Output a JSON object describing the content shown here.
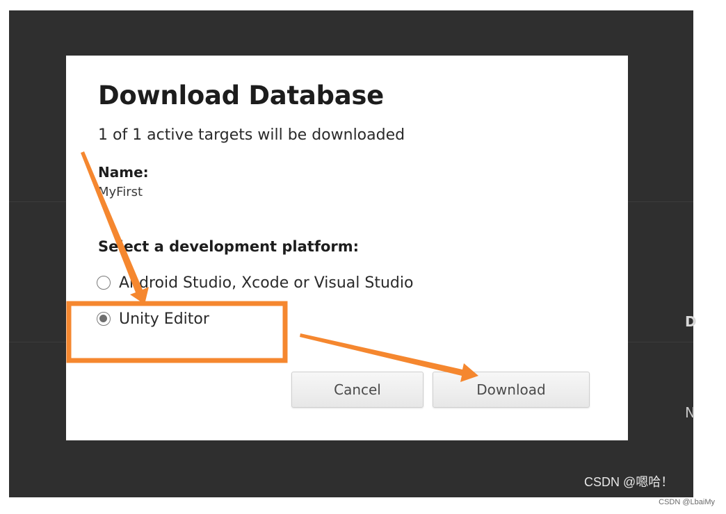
{
  "dialog": {
    "title": "Download Database",
    "subtitle": "1 of 1 active targets will be downloaded",
    "name_label": "Name:",
    "name_value": "MyFirst",
    "platform_label": "Select a development platform:",
    "platform_options": [
      {
        "label": "Android Studio, Xcode or Visual Studio",
        "selected": false
      },
      {
        "label": "Unity Editor",
        "selected": true
      }
    ],
    "buttons": {
      "cancel": "Cancel",
      "download": "Download"
    }
  },
  "background": {
    "clipped_right_chars": [
      "D",
      "N"
    ]
  },
  "watermarks": {
    "overlay": "CSDN @嗯哈！",
    "footer": "CSDN @LbaiMy"
  },
  "colors": {
    "backdrop": "#2f2f2f",
    "annotation_orange": "#f5872f"
  }
}
